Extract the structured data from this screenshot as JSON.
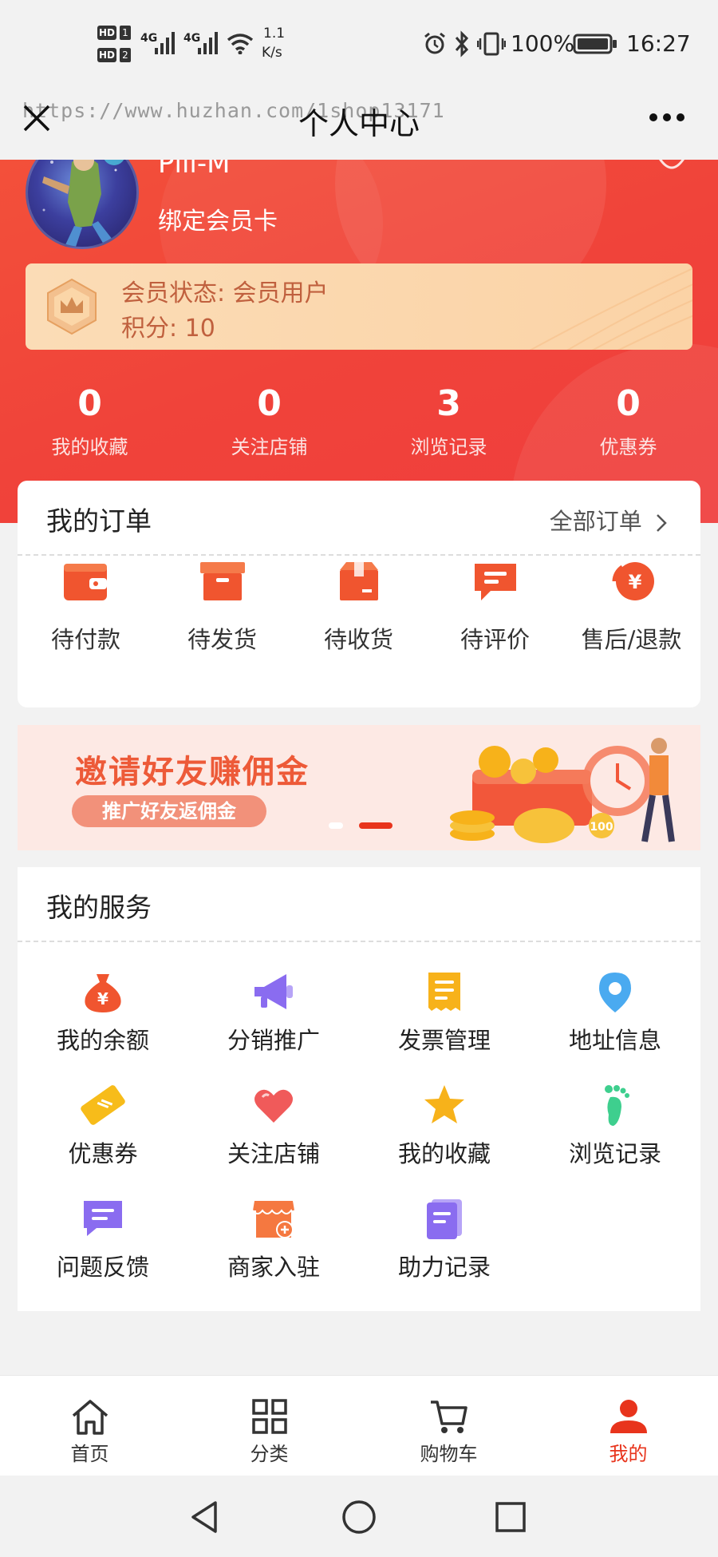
{
  "status_bar": {
    "hd1": "HD",
    "sim1": "1",
    "hd2": "HD",
    "sim2": "2",
    "net1": "4G",
    "net2": "4G",
    "speed_value": "1.1",
    "speed_unit": "K/s",
    "battery": "100%",
    "time": "16:27"
  },
  "nav": {
    "title": "个人中心",
    "watermark": "https://www.huzhan.com/1shop13171"
  },
  "profile": {
    "username": "Plll-M",
    "bind_card": "绑定会员卡",
    "vip_status": "会员状态: 会员用户",
    "points": "积分: 10"
  },
  "stats": [
    {
      "value": "0",
      "label": "我的收藏"
    },
    {
      "value": "0",
      "label": "关注店铺"
    },
    {
      "value": "3",
      "label": "浏览记录"
    },
    {
      "value": "0",
      "label": "优惠券"
    }
  ],
  "orders": {
    "title": "我的订单",
    "all_label": "全部订单",
    "items": [
      {
        "label": "待付款",
        "icon": "wallet-icon"
      },
      {
        "label": "待发货",
        "icon": "box-icon"
      },
      {
        "label": "待收货",
        "icon": "package-icon"
      },
      {
        "label": "待评价",
        "icon": "comment-icon"
      },
      {
        "label": "售后/退款",
        "icon": "refund-icon"
      }
    ]
  },
  "banner": {
    "title": "邀请好友赚佣金",
    "subtitle": "推广好友返佣金",
    "coin_text": "100"
  },
  "services": {
    "title": "我的服务",
    "items": [
      {
        "label": "我的余额",
        "icon": "money-bag-icon",
        "color": "#f0552f"
      },
      {
        "label": "分销推广",
        "icon": "megaphone-icon",
        "color": "#8a6cf0"
      },
      {
        "label": "发票管理",
        "icon": "receipt-icon",
        "color": "#f7b21a"
      },
      {
        "label": "地址信息",
        "icon": "location-pin-icon",
        "color": "#4aaaf0"
      },
      {
        "label": "优惠券",
        "icon": "coupon-icon",
        "color": "#f7bc1a"
      },
      {
        "label": "关注店铺",
        "icon": "heart-icon",
        "color": "#f05a5a"
      },
      {
        "label": "我的收藏",
        "icon": "star-icon",
        "color": "#f7b21a"
      },
      {
        "label": "浏览记录",
        "icon": "footprint-icon",
        "color": "#3ecf8e"
      },
      {
        "label": "问题反馈",
        "icon": "feedback-icon",
        "color": "#8a6cf0"
      },
      {
        "label": "商家入驻",
        "icon": "store-add-icon",
        "color": "#f57840"
      },
      {
        "label": "助力记录",
        "icon": "document-icon",
        "color": "#8a6cf0"
      }
    ]
  },
  "tabbar": {
    "items": [
      {
        "label": "首页",
        "icon": "home-icon"
      },
      {
        "label": "分类",
        "icon": "grid-icon"
      },
      {
        "label": "购物车",
        "icon": "cart-icon"
      },
      {
        "label": "我的",
        "icon": "user-icon"
      }
    ],
    "active_color": "#e8341c"
  },
  "colors": {
    "header": "#f0433a",
    "accent": "#f0552f",
    "vip_text": "#c0603e"
  }
}
